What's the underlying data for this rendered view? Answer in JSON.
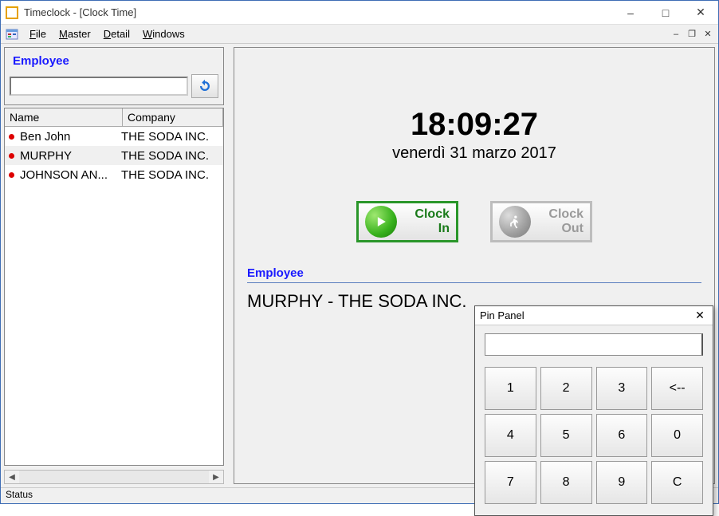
{
  "window": {
    "title": "Timeclock - [Clock Time]"
  },
  "menu": {
    "file": "File",
    "master": "Master",
    "detail": "Detail",
    "windows": "Windows"
  },
  "sidebar": {
    "header": "Employee",
    "search_value": "",
    "columns": {
      "name": "Name",
      "company": "Company"
    },
    "rows": [
      {
        "name": "Ben John",
        "company": "THE SODA INC."
      },
      {
        "name": "MURPHY",
        "company": "THE SODA INC."
      },
      {
        "name": "JOHNSON AN...",
        "company": "THE SODA INC."
      }
    ],
    "selected_index": 1
  },
  "clock": {
    "time": "18:09:27",
    "date": "venerdì 31 marzo 2017",
    "clock_in": "Clock In",
    "clock_out": "Clock Out"
  },
  "employee_detail": {
    "label": "Employee",
    "value": "MURPHY - THE SODA INC."
  },
  "pin_panel": {
    "title": "Pin Panel",
    "display": "",
    "keys": [
      "1",
      "2",
      "3",
      "<--",
      "4",
      "5",
      "6",
      "0",
      "7",
      "8",
      "9",
      "C"
    ]
  },
  "status": {
    "text": "Status"
  }
}
